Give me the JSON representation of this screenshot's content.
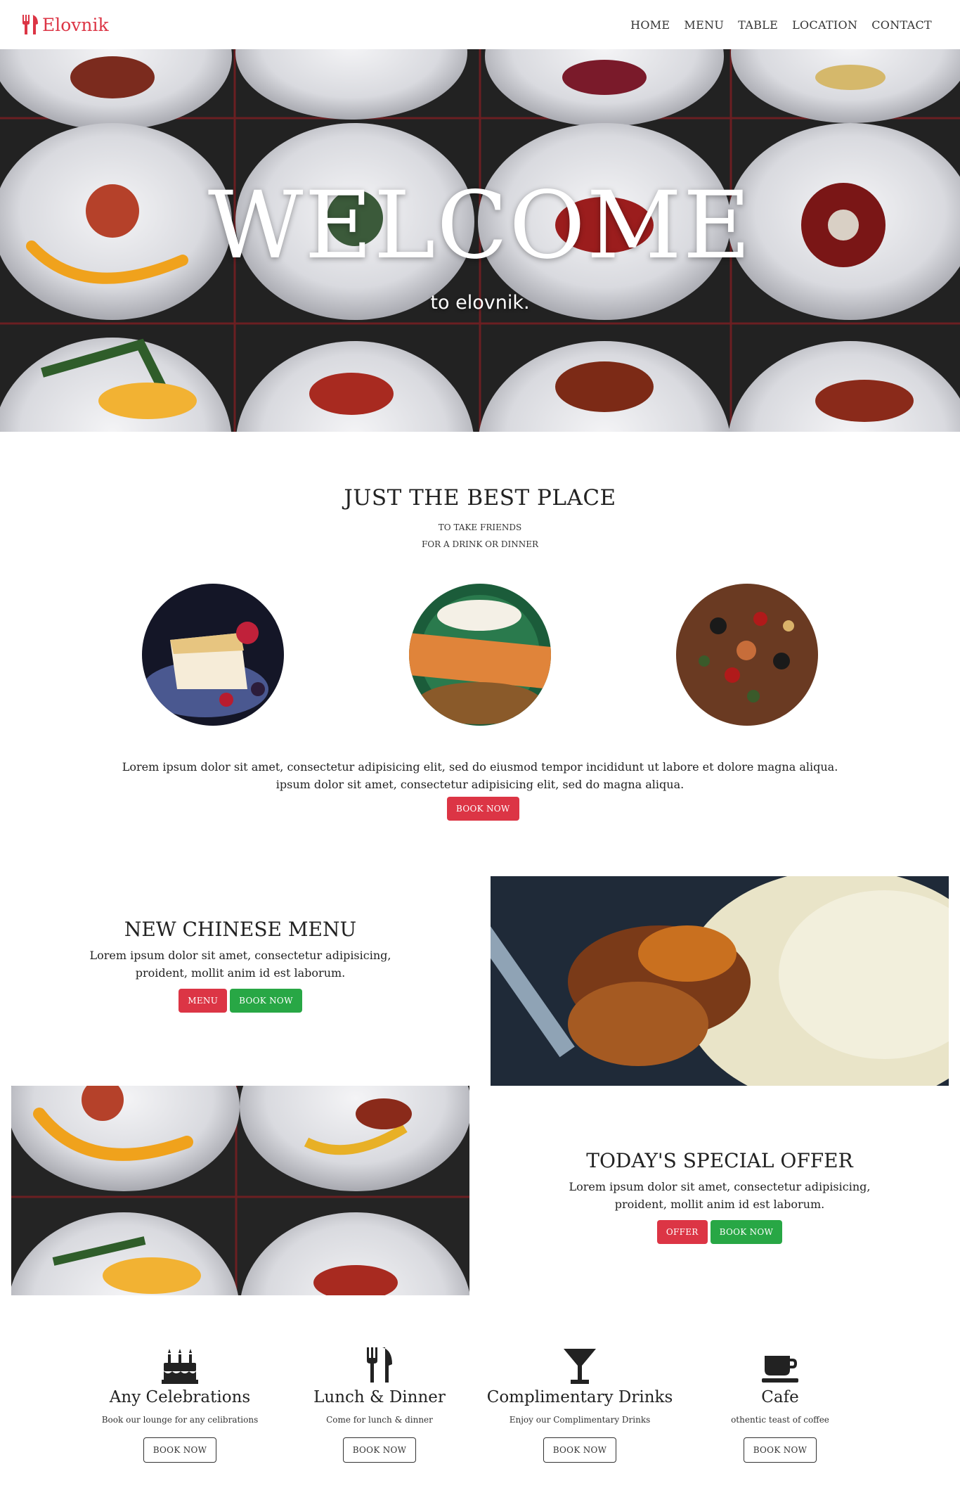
{
  "brand": {
    "name": "Elovnik",
    "accent": "#dc3545"
  },
  "nav": {
    "items": [
      "HOME",
      "MENU",
      "TABLE",
      "LOCATION",
      "CONTACT"
    ]
  },
  "hero": {
    "title": "WELCOME",
    "subtitle": "to elovnik."
  },
  "best": {
    "title": "JUST THE BEST PLACE",
    "tag_line_1": "TO TAKE FRIENDS",
    "tag_line_2": "FOR A DRINK OR DINNER",
    "text_line_1": "Lorem ipsum dolor sit amet, consectetur adipisicing elit, sed do eiusmod tempor incididunt ut labore et dolore magna aliqua.",
    "text_line_2": "ipsum dolor sit amet, consectetur adipisicing elit, sed do magna aliqua.",
    "book_label": "BOOK NOW"
  },
  "chinese": {
    "title": "NEW CHINESE MENU",
    "text_line_1": "Lorem ipsum dolor sit amet, consectetur adipisicing,",
    "text_line_2": "proident, mollit anim id est laborum.",
    "menu_label": "MENU",
    "book_label": "BOOK NOW"
  },
  "special": {
    "title": "TODAY'S SPECIAL OFFER",
    "text_line_1": "Lorem ipsum dolor sit amet, consectetur adipisicing,",
    "text_line_2": "proident, mollit anim id est laborum.",
    "offer_label": "OFFER",
    "book_label": "BOOK NOW"
  },
  "services": [
    {
      "name": "Any Celebrations",
      "desc": "Book our lounge for any celibrations",
      "icon": "birthday-cake-icon",
      "button": "BOOK NOW"
    },
    {
      "name": "Lunch & Dinner",
      "desc": "Come for lunch & dinner",
      "icon": "utensils-icon",
      "button": "BOOK NOW"
    },
    {
      "name": "Complimentary Drinks",
      "desc": "Enjoy our Complimentary Drinks",
      "icon": "cocktail-glass-icon",
      "button": "BOOK NOW"
    },
    {
      "name": "Cafe",
      "desc": "othentic teast of coffee",
      "icon": "coffee-cup-icon",
      "button": "BOOK NOW"
    }
  ],
  "colors": {
    "red": "#dc3545",
    "green": "#28a745",
    "dark": "#232323"
  }
}
